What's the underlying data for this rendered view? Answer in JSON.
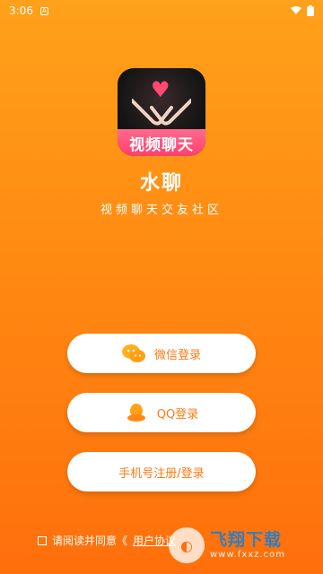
{
  "status": {
    "time": "3:06",
    "indicator": "A"
  },
  "app": {
    "icon_text": "视频聊天",
    "title": "水聊",
    "subtitle": "视频聊天交友社区"
  },
  "buttons": {
    "wechat": "微信登录",
    "qq": "QQ登录",
    "phone": "手机号注册/登录"
  },
  "agreement": {
    "prefix": "请阅读并同意《",
    "link": "用户协议"
  },
  "watermark": {
    "main": "飞翔下载",
    "sub": "www.fxxz.com"
  },
  "colors": {
    "bg_top": "#ffa11a",
    "bg_bottom": "#ff6f0c",
    "accent": "#ff7a14"
  }
}
